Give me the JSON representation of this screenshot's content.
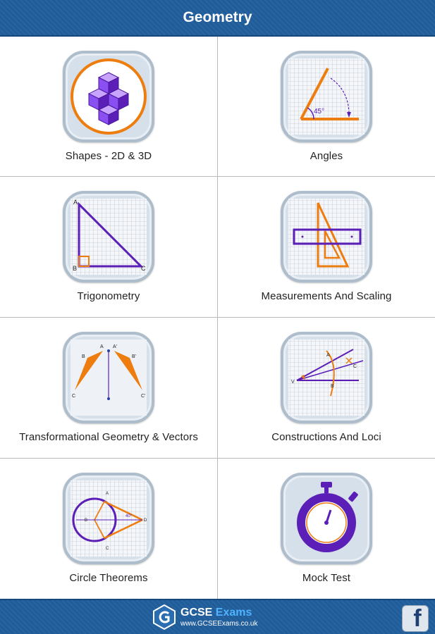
{
  "header": {
    "title": "Geometry"
  },
  "tiles": [
    {
      "label": "Shapes - 2D & 3D",
      "icon": "cubes-icon"
    },
    {
      "label": "Angles",
      "icon": "angle-icon",
      "angle_text": "45°"
    },
    {
      "label": "Trigonometry",
      "icon": "right-triangle-icon",
      "vertices": [
        "A",
        "B",
        "C"
      ]
    },
    {
      "label": "Measurements And Scaling",
      "icon": "ruler-set-square-icon"
    },
    {
      "label": "Transformational Geometry & Vectors",
      "icon": "reflection-icon",
      "vertices": [
        "A",
        "B",
        "C",
        "A'",
        "B'",
        "C'"
      ]
    },
    {
      "label": "Constructions And Loci",
      "icon": "bisector-icon",
      "vertices": [
        "A",
        "B",
        "C",
        "V"
      ]
    },
    {
      "label": "Circle Theorems",
      "icon": "circle-tangent-icon",
      "vertices": [
        "A",
        "B",
        "C",
        "D"
      ],
      "angle_text": "40°"
    },
    {
      "label": "Mock Test",
      "icon": "stopwatch-icon"
    }
  ],
  "footer": {
    "brand_name_1": "GCSE",
    "brand_name_2": "Exams",
    "brand_url": "www.GCSEExams.co.uk",
    "facebook_glyph": "f"
  },
  "colors": {
    "header_blue": "#1f5c9a",
    "orange": "#ee7d0f",
    "purple": "#5b1fb8",
    "icon_frame": "#d6e0ea"
  }
}
